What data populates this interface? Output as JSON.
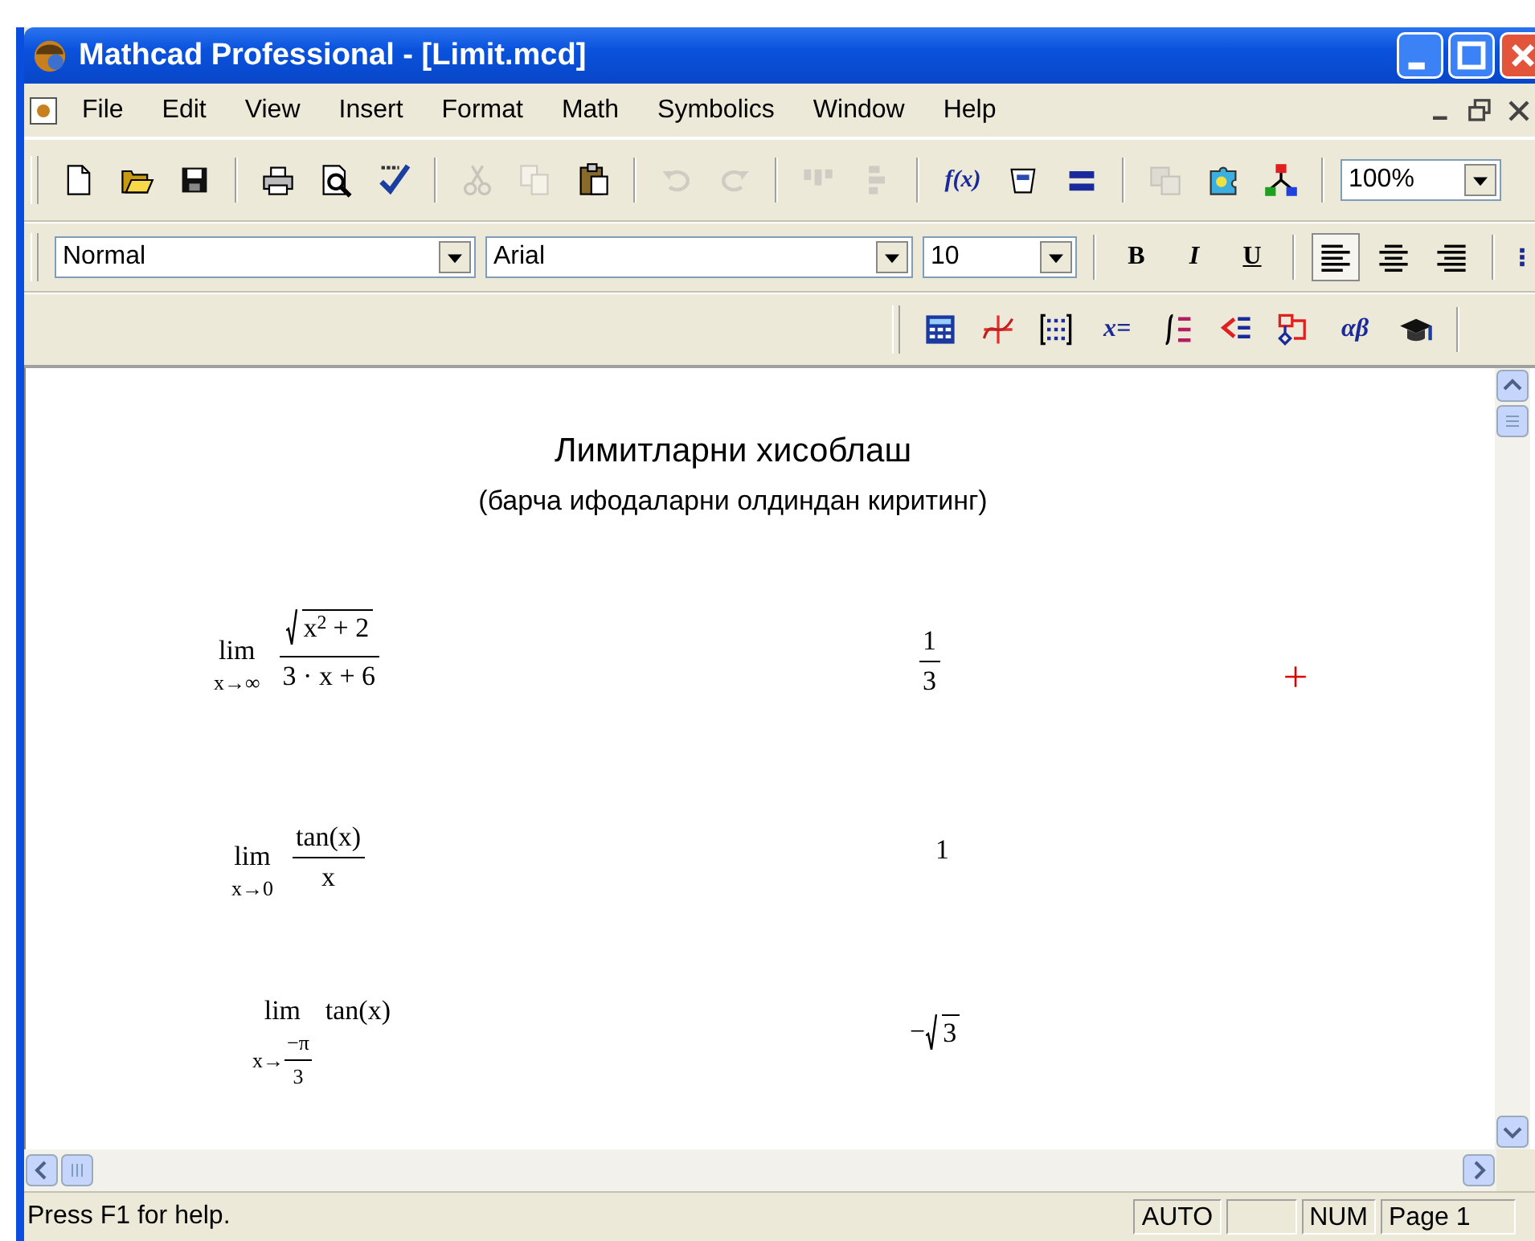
{
  "window": {
    "title": "Mathcad Professional - [Limit.mcd]"
  },
  "menu": [
    {
      "label": "File"
    },
    {
      "label": "Edit"
    },
    {
      "label": "View"
    },
    {
      "label": "Insert"
    },
    {
      "label": "Format"
    },
    {
      "label": "Math"
    },
    {
      "label": "Symbolics"
    },
    {
      "label": "Window"
    },
    {
      "label": "Help"
    }
  ],
  "standard_toolbar": {
    "groups": [
      [
        {
          "disabled": false
        },
        {
          "disabled": false
        },
        {
          "disabled": false
        }
      ],
      [
        {
          "disabled": false
        },
        {
          "disabled": false
        },
        {
          "disabled": false
        }
      ],
      [
        {
          "disabled": true
        },
        {
          "disabled": true
        },
        {
          "disabled": false
        }
      ],
      [
        {
          "disabled": true
        },
        {
          "disabled": true
        }
      ],
      [
        {
          "disabled": true
        },
        {
          "disabled": true
        }
      ],
      [
        {
          "disabled": false,
          "label": "f(x)"
        },
        {
          "disabled": false
        },
        {
          "disabled": false
        }
      ],
      [
        {
          "disabled": true
        },
        {
          "disabled": false
        },
        {
          "disabled": false
        }
      ]
    ],
    "zoom": "100%"
  },
  "format_toolbar": {
    "style": "Normal",
    "font": "Arial",
    "size": "10",
    "text_buttons": [
      {
        "label": "B",
        "selected": false
      },
      {
        "label": "I",
        "selected": false
      },
      {
        "label": "U",
        "selected": false
      }
    ],
    "align_buttons": [
      {
        "selected": true
      },
      {
        "selected": false
      },
      {
        "selected": false
      }
    ]
  },
  "math_toolbar": [
    {
      "kind": "icon"
    },
    {
      "kind": "icon"
    },
    {
      "kind": "icon"
    },
    {
      "kind": "label",
      "label": "x="
    },
    {
      "kind": "icon"
    },
    {
      "kind": "icon"
    },
    {
      "kind": "icon"
    },
    {
      "kind": "label",
      "label": "αβ"
    },
    {
      "kind": "icon"
    }
  ],
  "worksheet": {
    "title": "Лимитларни хисоблаш",
    "subtitle": "(барча ифодаларни олдиндан киритинг)",
    "limits": [
      {
        "operator": "lim",
        "below": {
          "kind": "text",
          "text": "x→∞"
        },
        "expression": {
          "kind": "fraction",
          "num": {
            "kind": "sqrt",
            "body": {
              "kind": "row",
              "items": [
                {
                  "kind": "power",
                  "base": "x",
                  "exp": "2"
                },
                {
                  "kind": "text",
                  "text": "+ 2"
                }
              ]
            }
          },
          "den": {
            "kind": "text",
            "text": "3 · x + 6"
          }
        },
        "result": {
          "kind": "fraction",
          "num": {
            "kind": "text",
            "text": "1"
          },
          "den": {
            "kind": "text",
            "text": "3"
          }
        }
      },
      {
        "operator": "lim",
        "below": {
          "kind": "text",
          "text": "x→0"
        },
        "expression": {
          "kind": "fraction",
          "num": {
            "kind": "text",
            "text": "tan(x)"
          },
          "den": {
            "kind": "text",
            "text": "x"
          }
        },
        "result": {
          "kind": "text",
          "text": "1"
        }
      },
      {
        "operator": "lim",
        "below": {
          "kind": "row",
          "items": [
            {
              "kind": "text",
              "text": "x→"
            },
            {
              "kind": "fraction",
              "num": {
                "kind": "text",
                "text": "−π"
              },
              "den": {
                "kind": "text",
                "text": "3"
              }
            }
          ]
        },
        "expression": {
          "kind": "text",
          "text": "tan(x)"
        },
        "result": {
          "kind": "row",
          "items": [
            {
              "kind": "text",
              "text": "−"
            },
            {
              "kind": "sqrt",
              "body": {
                "kind": "text",
                "text": "3"
              }
            }
          ]
        }
      }
    ],
    "cursor": true
  },
  "status_bar": {
    "message": "Press F1 for help.",
    "panels": [
      "AUTO",
      "NUM",
      "Page 1"
    ]
  }
}
